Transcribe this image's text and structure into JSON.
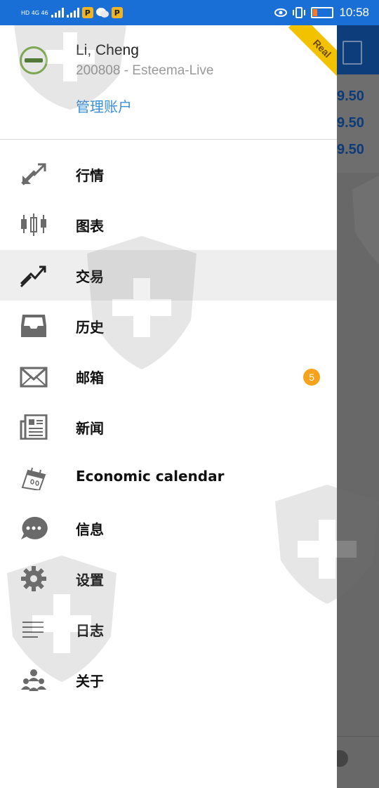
{
  "status_bar": {
    "network_left": "HD 4G 46",
    "app_icon_label": "P",
    "time": "10:58"
  },
  "account": {
    "name": "Li, Cheng",
    "number_line": "200808 - Esteema-Live",
    "manage_label": "管理账户",
    "ribbon": "Real"
  },
  "background_app": {
    "prices": [
      "9.50",
      "9.50",
      "9.50"
    ]
  },
  "menu": {
    "items": [
      {
        "label": "行情",
        "icon": "quotes-arrows-icon"
      },
      {
        "label": "图表",
        "icon": "candlestick-chart-icon"
      },
      {
        "label": "交易",
        "icon": "trade-trend-icon",
        "active": true
      },
      {
        "label": "历史",
        "icon": "history-inbox-icon"
      },
      {
        "label": "邮箱",
        "icon": "mail-envelope-icon",
        "badge": "5"
      },
      {
        "label": "新闻",
        "icon": "news-paper-icon"
      },
      {
        "label": "Economic calendar",
        "icon": "calendar-icon"
      },
      {
        "label": "信息",
        "icon": "chat-bubble-icon"
      },
      {
        "label": "设置",
        "icon": "gear-icon"
      },
      {
        "label": "日志",
        "icon": "journal-lines-icon"
      },
      {
        "label": "关于",
        "icon": "about-community-icon"
      }
    ]
  },
  "colors": {
    "status_bar": "#1a6fd6",
    "link": "#3a8fdc",
    "badge": "#f7a21b",
    "ribbon": "#f2c200",
    "active_row": "#eeeeee",
    "icon_gray": "#6a6a6a"
  }
}
